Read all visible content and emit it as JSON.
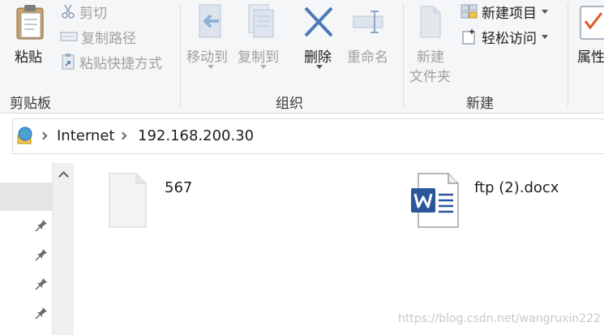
{
  "ribbon": {
    "clipboard": {
      "paste_label": "粘贴",
      "cut_label": "剪切",
      "copy_path_label": "复制路径",
      "paste_shortcut_label": "粘贴快捷方式",
      "group_label": "剪贴板"
    },
    "organize": {
      "move_to_label": "移动到",
      "copy_to_label": "复制到",
      "delete_label": "删除",
      "rename_label": "重命名",
      "group_label": "组织"
    },
    "new": {
      "new_folder_label_line1": "新建",
      "new_folder_label_line2": "文件夹",
      "new_item_label": "新建项目",
      "easy_access_label": "轻松访问",
      "group_label": "新建"
    },
    "open": {
      "properties_label": "属性"
    }
  },
  "address_bar": {
    "crumbs": [
      "Internet",
      "192.168.200.30"
    ]
  },
  "files": [
    {
      "name": "567",
      "type": "blank-file"
    },
    {
      "name": "ftp (2).docx",
      "type": "word-document"
    }
  ],
  "watermark": "https://blog.csdn.net/wangruxin222",
  "colors": {
    "ribbon_bg": "#f5f6f7",
    "word_blue": "#2b579a",
    "delete_blue": "#4a7ab8",
    "nav_selected": "#e5e5e5"
  }
}
